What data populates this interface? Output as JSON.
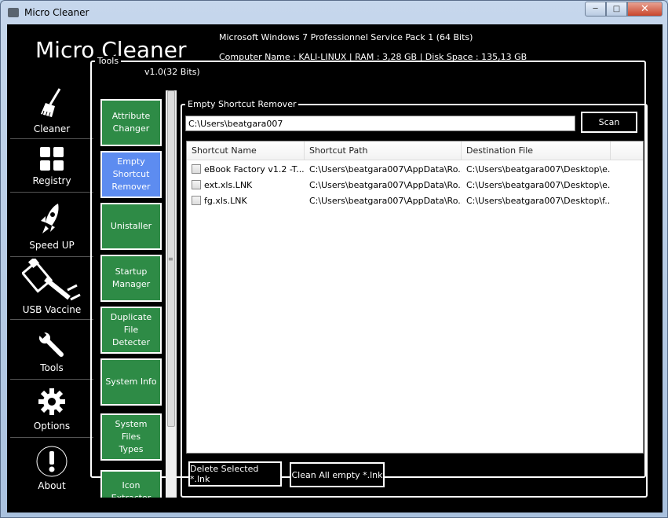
{
  "window": {
    "title": "Micro Cleaner"
  },
  "header": {
    "app_title": "Micro Cleaner",
    "version": "v1.0(32 Bits)",
    "os_info": "Microsoft Windows 7 Professionnel Service Pack 1 (64 Bits)",
    "computer_info": "Computer Name : KALI-LINUX | RAM : 3,28 GB | Disk Space : 135,13 GB"
  },
  "nav": {
    "items": [
      {
        "label": "Cleaner",
        "icon": "broom-icon"
      },
      {
        "label": "Registry",
        "icon": "registry-grid-icon"
      },
      {
        "label": "Speed UP",
        "icon": "rocket-icon"
      },
      {
        "label": "USB Vaccine",
        "icon": "usb-syringe-icon"
      },
      {
        "label": "Tools",
        "icon": "wrench-icon"
      },
      {
        "label": "Options",
        "icon": "gear-icon"
      },
      {
        "label": "About",
        "icon": "exclamation-icon"
      }
    ]
  },
  "tools": {
    "legend": "Tools",
    "buttons": [
      {
        "label": "Attribute\nChanger"
      },
      {
        "label": "Empty\nShortcut\nRemover",
        "active": true
      },
      {
        "label": "Unistaller"
      },
      {
        "label": "Startup\nManager"
      },
      {
        "label": "Duplicate\nFile\nDetecter"
      },
      {
        "label": "System Info"
      },
      {
        "label": "System\nFiles\nTypes"
      },
      {
        "label": "Icon\nExtractor"
      }
    ]
  },
  "remover": {
    "legend": "Empty Shortcut Remover",
    "path_value": "C:\\Users\\beatgara007",
    "scan_label": "Scan",
    "columns": [
      "Shortcut Name",
      "Shortcut Path",
      "Destination File"
    ],
    "rows": [
      {
        "name": "eBook Factory v1.2 -T...",
        "path": "C:\\Users\\beatgara007\\AppData\\Ro...",
        "dest": "C:\\Users\\beatgara007\\Desktop\\e..."
      },
      {
        "name": "ext.xls.LNK",
        "path": "C:\\Users\\beatgara007\\AppData\\Ro...",
        "dest": "C:\\Users\\beatgara007\\Desktop\\e..."
      },
      {
        "name": "fg.xls.LNK",
        "path": "C:\\Users\\beatgara007\\AppData\\Ro...",
        "dest": "C:\\Users\\beatgara007\\Desktop\\f..."
      }
    ],
    "delete_label": "Delete Selected *.lnk",
    "clean_label": "Clean All empty *.lnk"
  },
  "colors": {
    "tool_green": "#2e8b46",
    "tool_active": "#5d8cf0",
    "background": "#000000"
  }
}
